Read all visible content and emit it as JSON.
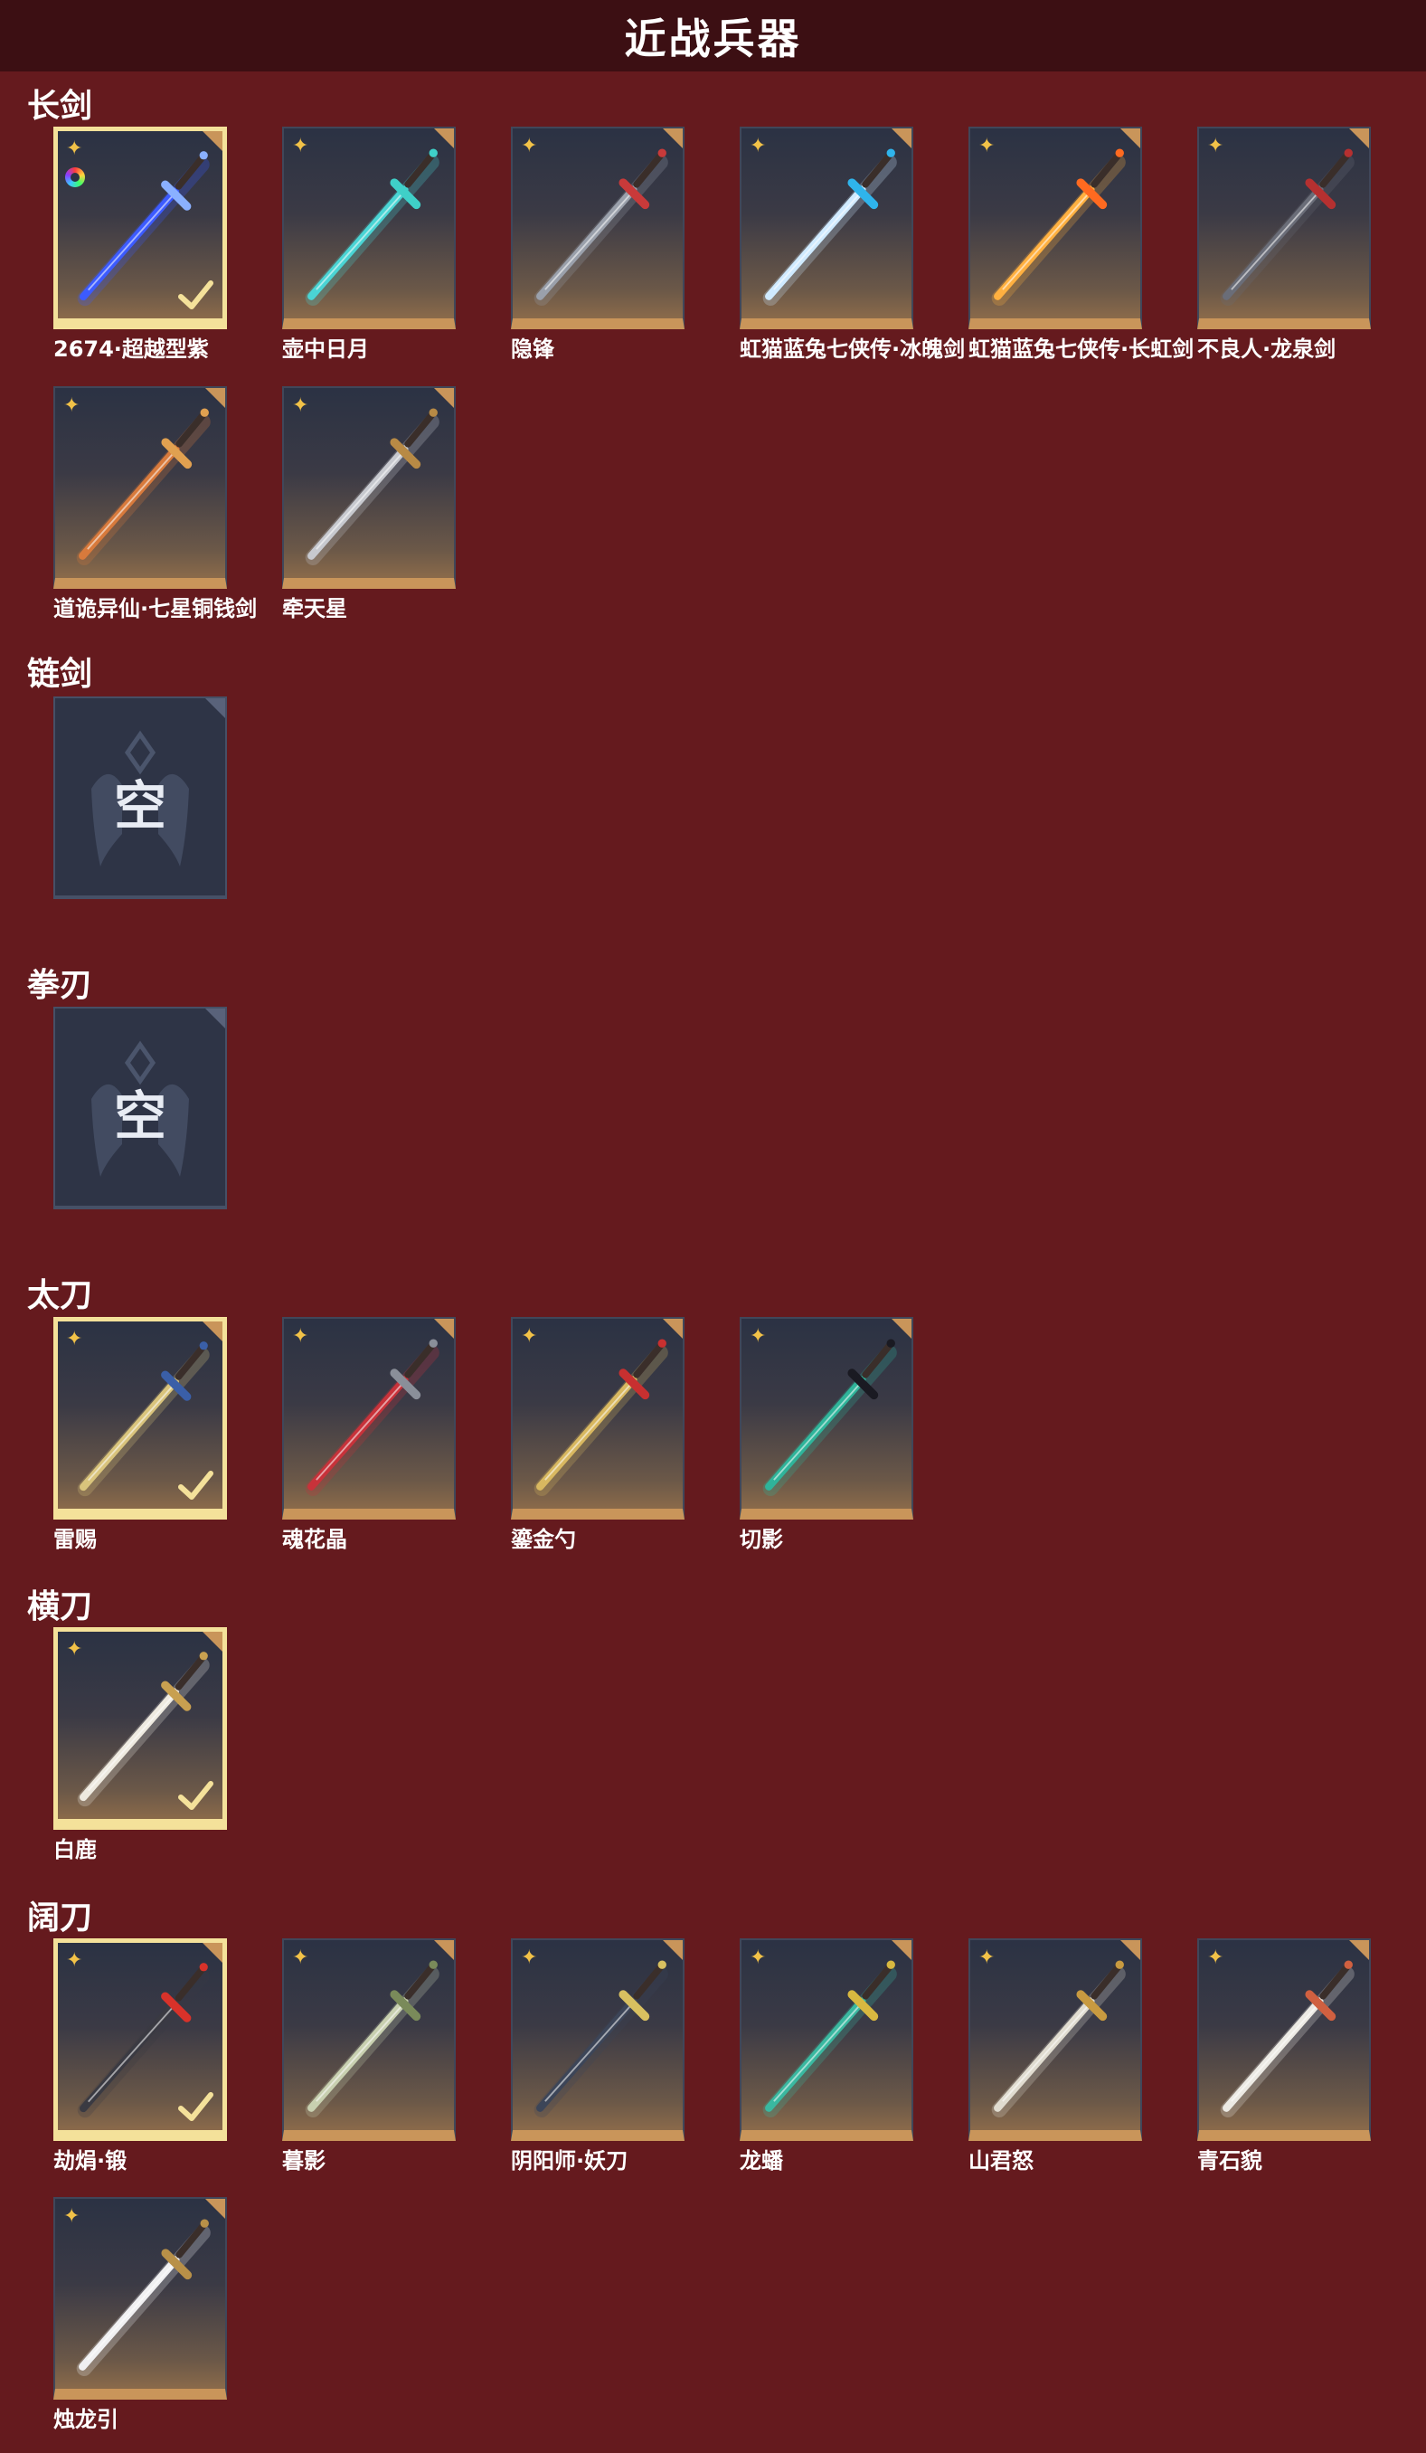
{
  "header": {
    "title": "近战兵器"
  },
  "icons": {
    "rarity": "star-icon",
    "selected": "checkmark-icon",
    "unique": "rainbow-ring-icon",
    "corner": "corner-tab-icon"
  },
  "colors": {
    "background": "#651a1e",
    "header": "#3c0f13",
    "selected_border": "#f4e19a",
    "card_bottom": "#c9955a",
    "star": "#f2c248"
  },
  "sections": [
    {
      "title": "长剑",
      "items": [
        {
          "name": "2674·超越型紫",
          "selected": true,
          "unique": true,
          "blade": "#3c5bff",
          "accent": "#8ab0ff"
        },
        {
          "name": "壶中日月",
          "selected": false,
          "blade": "#4ad4d4",
          "accent": "#3fd0c8"
        },
        {
          "name": "隐锋",
          "selected": false,
          "blade": "#9aa0ab",
          "accent": "#c83a3a"
        },
        {
          "name": "虹猫蓝兔七侠传·冰魄剑",
          "selected": false,
          "blade": "#cfeaff",
          "accent": "#2fb4ec"
        },
        {
          "name": "虹猫蓝兔七侠传·长虹剑",
          "selected": false,
          "blade": "#ffb040",
          "accent": "#ff6a20"
        },
        {
          "name": "不良人·龙泉剑",
          "selected": false,
          "blade": "#6a6d78",
          "accent": "#b53030"
        },
        {
          "name": "道诡异仙·七星铜钱剑",
          "selected": false,
          "blade": "#d87a3c",
          "accent": "#e0a050"
        },
        {
          "name": "牵天星",
          "selected": false,
          "blade": "#c7c9cf",
          "accent": "#b88a45"
        }
      ]
    },
    {
      "title": "链剑",
      "empty_text": "空",
      "items": []
    },
    {
      "title": "拳刃",
      "empty_text": "空",
      "items": []
    },
    {
      "title": "太刀",
      "items": [
        {
          "name": "雷赐",
          "selected": true,
          "blade": "#d9c47c",
          "accent": "#3a5fa8"
        },
        {
          "name": "魂花晶",
          "selected": false,
          "blade": "#c8323a",
          "accent": "#8a8f99"
        },
        {
          "name": "鎏金勺",
          "selected": false,
          "blade": "#d8b860",
          "accent": "#c83030"
        },
        {
          "name": "切影",
          "selected": false,
          "blade": "#2fb49a",
          "accent": "#1a1a22"
        }
      ]
    },
    {
      "title": "横刀",
      "items": [
        {
          "name": "白鹿",
          "selected": true,
          "blade": "#eeeae0",
          "accent": "#c8a050"
        }
      ]
    },
    {
      "title": "阔刀",
      "items": [
        {
          "name": "劫焆·锻",
          "selected": true,
          "blade": "#3a3a42",
          "accent": "#d8322a"
        },
        {
          "name": "暮影",
          "selected": false,
          "blade": "#c8d0b0",
          "accent": "#7a8a5a"
        },
        {
          "name": "阴阳师·妖刀",
          "selected": false,
          "blade": "#3c4558",
          "accent": "#d8c060"
        },
        {
          "name": "龙蟠",
          "selected": false,
          "blade": "#3ab8a0",
          "accent": "#d8b840"
        },
        {
          "name": "山君怒",
          "selected": false,
          "blade": "#e0dcd0",
          "accent": "#c89a40"
        },
        {
          "name": "青石貌",
          "selected": false,
          "blade": "#eceae4",
          "accent": "#d06040"
        },
        {
          "name": "烛龙引",
          "selected": false,
          "blade": "#f0f0f2",
          "accent": "#b89048"
        }
      ]
    }
  ]
}
